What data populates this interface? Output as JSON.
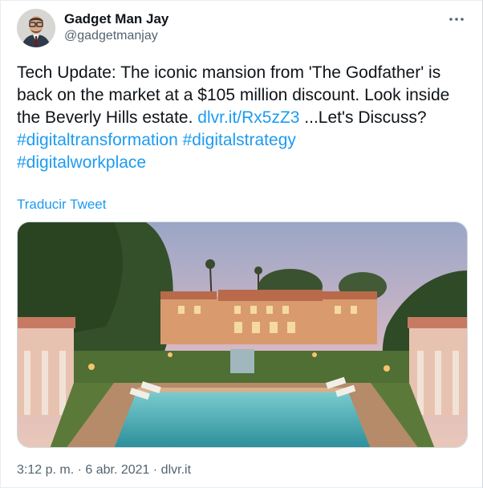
{
  "tweet": {
    "author_name": "Gadget Man Jay",
    "author_handle": "@gadgetmanjay",
    "text_intro": "Tech Update:  The iconic mansion from 'The Godfather' is back on the market at a $105 million discount. Look inside the Beverly Hills estate. ",
    "link": "dlvr.it/Rx5zZ3",
    "text_after_link": " ...Let's Discuss?",
    "hashtags": [
      "#digitaltransformation",
      "#digitalstrategy",
      "#digitalworkplace"
    ],
    "translate_label": "Traducir Tweet",
    "time": "3:12 p. m.",
    "separator": " · ",
    "date": "6 abr. 2021",
    "source": "dlvr.it"
  },
  "icons": {
    "more": "more-horizontal-icon"
  },
  "colors": {
    "link": "#1d9bf0",
    "muted": "#536471",
    "text": "#0f1419"
  }
}
